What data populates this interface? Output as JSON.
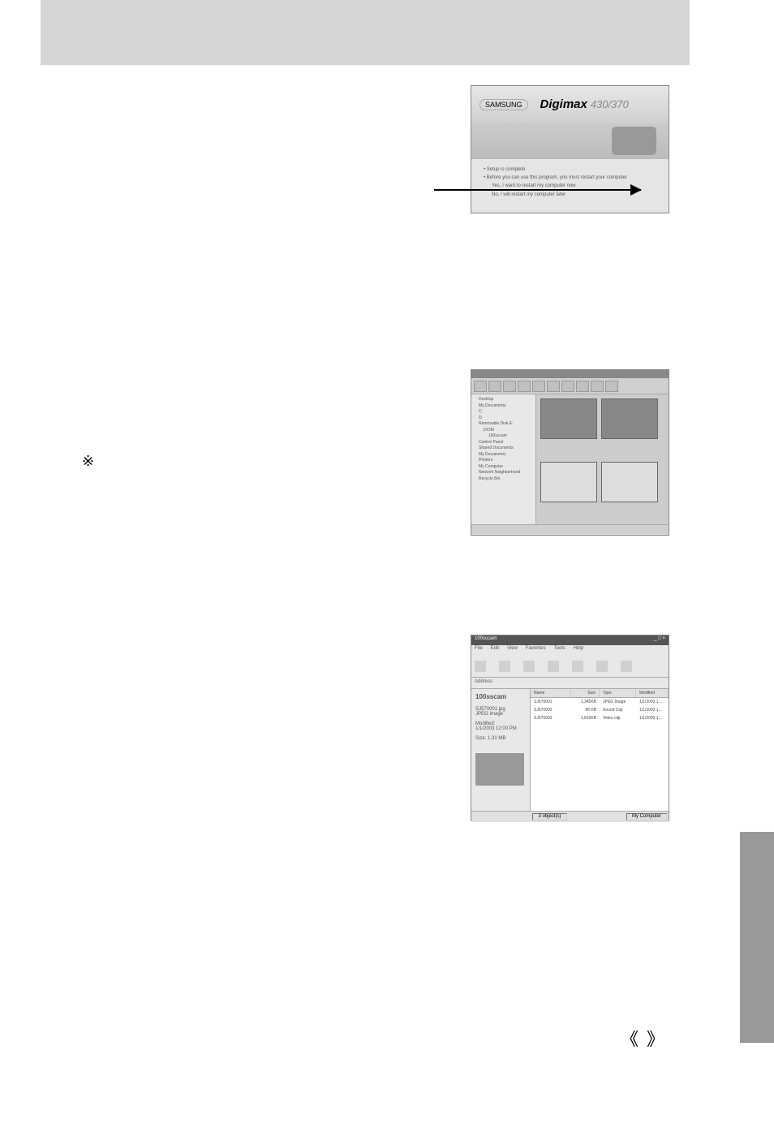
{
  "header": {
    "title": ""
  },
  "ref_mark": "※",
  "page_marks": {
    "left": "《",
    "right": "》"
  },
  "installer": {
    "brand": "SAMSUNG",
    "product": "Digimax",
    "model": "430/370",
    "option1_heading": "• Setup is complete",
    "option1_sub": "• Before you can use this program, you must restart your computer",
    "radio1": "Yes, I want to restart my computer now",
    "radio2": "No, I will restart my computer later"
  },
  "viewer": {
    "tree": [
      "Desktop",
      "My Documents",
      "C:",
      "D:",
      "Removable Disk E:",
      "DCIM",
      "100sscam",
      "Control Panel",
      "Shared Documents",
      "My Documents",
      "Printers",
      "My Computer",
      "Network Neighborhood",
      "Recycle Bin"
    ]
  },
  "explorer": {
    "title": "100sscam",
    "menus": [
      "File",
      "Edit",
      "View",
      "Favorites",
      "Tools",
      "Help"
    ],
    "address_label": "Address",
    "folder_name": "100sscam",
    "file_selected": "SJ570001.jpg",
    "file_type": "JPEG Image",
    "file_mod_label": "Modified:",
    "file_mod": "1/1/2003 12:00 PM",
    "file_size_label": "Size:",
    "file_size": "1.31 MB",
    "columns": [
      "Name",
      "Size",
      "Type",
      "Modified"
    ],
    "rows": [
      {
        "name": "SJ570001",
        "size": "1,345KB",
        "type": "JPEG Image",
        "mod": "1/1/2003 1..."
      },
      {
        "name": "SJ570002",
        "size": "96 KB",
        "type": "Sound Clip",
        "mod": "1/1/2003 1..."
      },
      {
        "name": "SJ570003",
        "size": "1,816KB",
        "type": "Video clip",
        "mod": "1/1/2003 1..."
      }
    ],
    "status_left": "3 object(s)",
    "status_right": "My Computer"
  }
}
